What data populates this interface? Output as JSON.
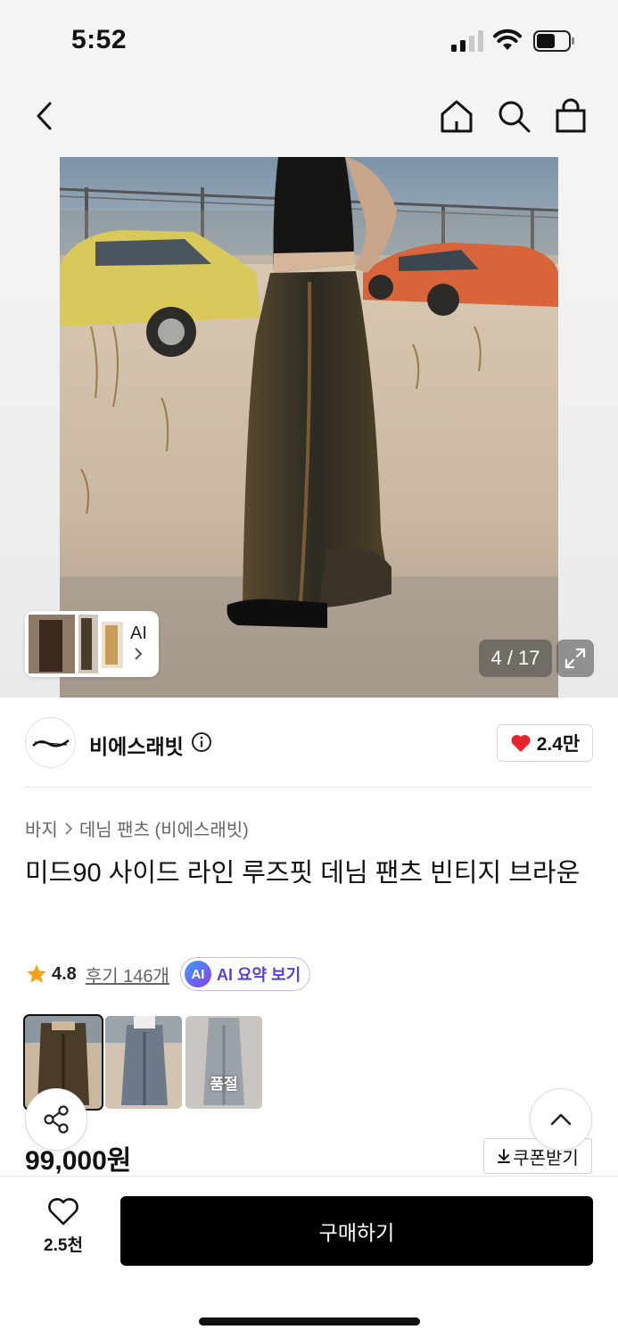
{
  "status_bar": {
    "time": "5:52"
  },
  "nav": {
    "back_icon": "chevron-left-icon",
    "home_icon": "home-icon",
    "search_icon": "search-icon",
    "bag_icon": "shopping-bag-icon"
  },
  "gallery": {
    "ai_label": "AI",
    "counter": "4 / 17",
    "expand_icon": "expand-icon"
  },
  "brand": {
    "name": "비에스래빗",
    "info_icon": "info-icon",
    "like_count": "2.4만",
    "like_icon": "heart-filled-icon",
    "like_color": "#e8232b"
  },
  "product": {
    "breadcrumb": [
      "바지",
      "데님 팬츠 (비에스래빗)"
    ],
    "title": "미드90 사이드 라인 루즈핏 데님 팬츠 빈티지 브라운",
    "rating": "4.8",
    "review_link": "후기 146개",
    "ai_badge": "AI",
    "ai_summary": "AI 요약 보기",
    "color_options": [
      {
        "selected": true,
        "soldout_label": ""
      },
      {
        "selected": false,
        "soldout_label": ""
      },
      {
        "selected": false,
        "soldout_label": "품절"
      }
    ],
    "price": "99,000원",
    "coupon": "쿠폰받기"
  },
  "bottom_bar": {
    "wish_count": "2.5천",
    "buy_label": "구매하기"
  }
}
